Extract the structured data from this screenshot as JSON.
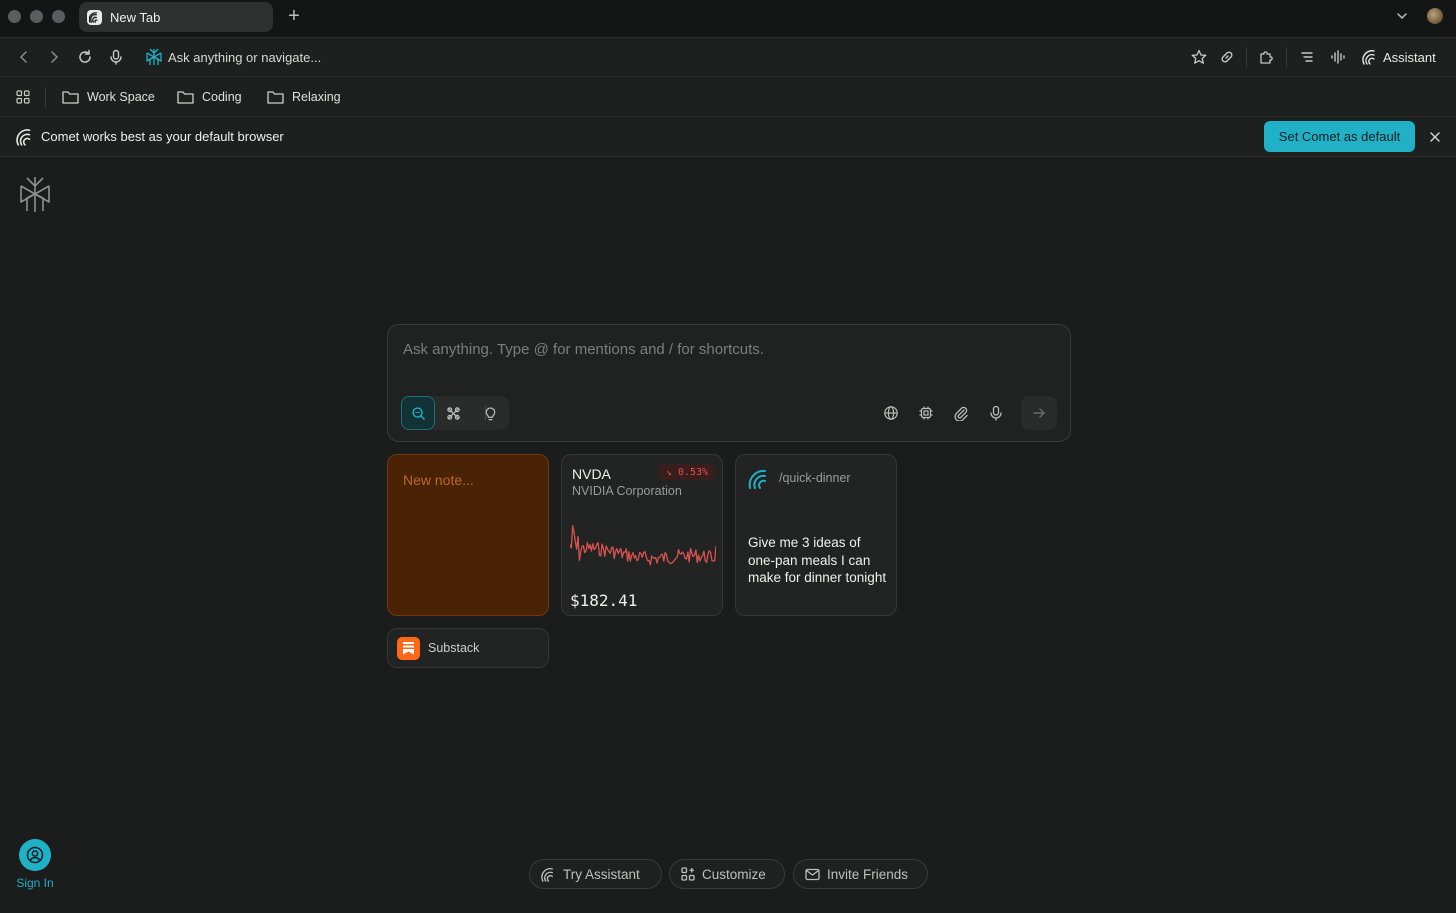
{
  "window": {
    "tab": {
      "title": "New Tab"
    }
  },
  "navbar": {
    "omnibox_placeholder": "Ask anything or navigate...",
    "assistant_label": "Assistant"
  },
  "bookmarks": [
    {
      "label": "Work Space",
      "icon": "folder-icon"
    },
    {
      "label": "Coding",
      "icon": "folder-icon"
    },
    {
      "label": "Relaxing",
      "icon": "folder-icon"
    }
  ],
  "banner": {
    "message": "Comet works best as your default browser",
    "action_label": "Set Comet as default"
  },
  "composer": {
    "placeholder": "Ask anything. Type @ for mentions and / for shortcuts.",
    "modes": [
      "search-icon",
      "research-icon",
      "lightbulb-icon"
    ],
    "active_mode": "search-icon",
    "tools": [
      "globe-icon",
      "cpu-icon",
      "paperclip-icon",
      "microphone-icon"
    ]
  },
  "cards": {
    "note": {
      "placeholder": "New note..."
    },
    "stock": {
      "ticker": "NVDA",
      "company": "NVIDIA Corporation",
      "change": "↘ 0.53%",
      "price": "$182.41",
      "trend_color": "#d9534f"
    },
    "prompt": {
      "command": "/quick-dinner",
      "text": "Give me 3 ideas of one-pan meals I can make for dinner tonight"
    },
    "shortcut": {
      "label": "Substack"
    }
  },
  "sidebar": {
    "sign_in_label": "Sign In"
  },
  "footer": {
    "try_assistant": "Try Assistant",
    "customize": "Customize",
    "invite_friends": "Invite Friends"
  },
  "colors": {
    "accent": "#20b1c6",
    "background": "#1b1c1c",
    "note_bg": "#4a2206",
    "negative": "#e0524e"
  }
}
